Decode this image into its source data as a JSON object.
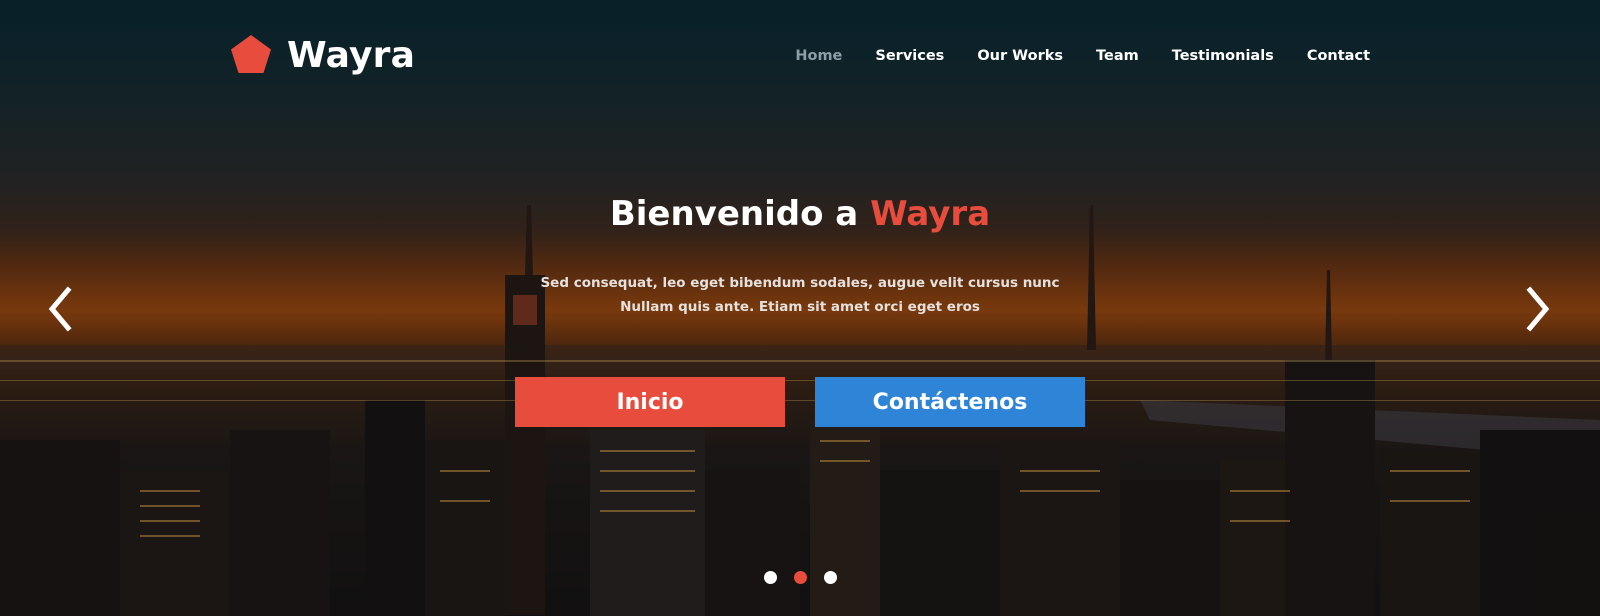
{
  "brand": {
    "name": "Wayra",
    "logo_icon": "pentagon-icon",
    "accent_color": "#e74c3c"
  },
  "nav": {
    "items": [
      {
        "label": "Home",
        "active": true
      },
      {
        "label": "Services",
        "active": false
      },
      {
        "label": "Our Works",
        "active": false
      },
      {
        "label": "Team",
        "active": false
      },
      {
        "label": "Testimonials",
        "active": false
      },
      {
        "label": "Contact",
        "active": false
      }
    ]
  },
  "hero": {
    "title_prefix": "Bienvenido a ",
    "title_accent": "Wayra",
    "subtitle_line1": "Sed consequat, leo eget bibendum sodales, augue velit cursus nunc",
    "subtitle_line2": "Nullam quis ante. Etiam sit amet orci eget eros",
    "button_primary": {
      "label": "Inicio",
      "color": "#e74c3c"
    },
    "button_secondary": {
      "label": "Contáctenos",
      "color": "#2e85d8"
    }
  },
  "carousel": {
    "prev_icon": "chevron-left-icon",
    "next_icon": "chevron-right-icon",
    "slide_count": 3,
    "active_slide": 2
  }
}
